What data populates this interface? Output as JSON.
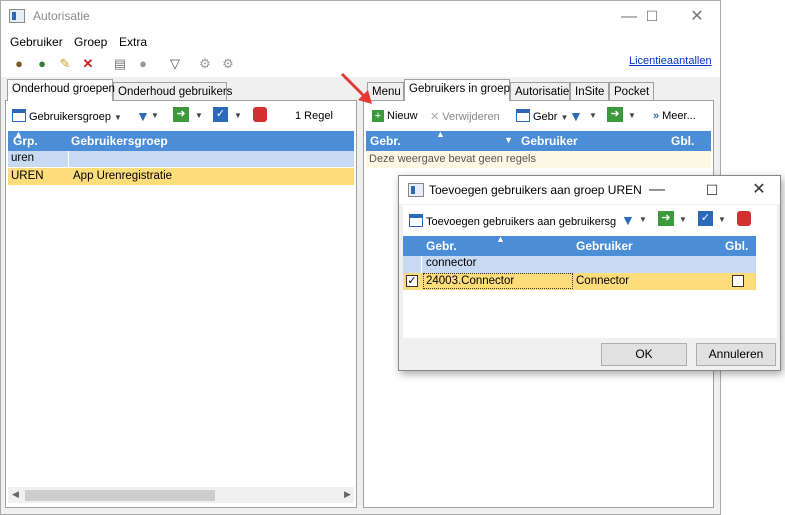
{
  "window": {
    "title": "Autorisatie"
  },
  "menu": {
    "items": [
      "Gebruiker",
      "Groep",
      "Extra"
    ]
  },
  "toolbar": {
    "link": "Licentieaantallen"
  },
  "left": {
    "tabs": [
      "Onderhoud groepen",
      "Onderhoud gebruikers"
    ],
    "buttons": {
      "group": "Gebruikersgroep",
      "count": "1 Regel"
    },
    "columns": [
      "Grp.",
      "Gebruikersgroep"
    ],
    "filter": "uren",
    "rows": [
      {
        "code": "UREN",
        "name": "App Urenregistratie"
      }
    ]
  },
  "right": {
    "tabs": [
      "Menu",
      "Gebruikers in groep",
      "Autorisatie",
      "InSite",
      "Pocket"
    ],
    "buttons": {
      "new": "Nieuw",
      "delete": "Verwijderen",
      "user": "Gebr",
      "more": "Meer..."
    },
    "columns": [
      "Gebr.",
      "Gebruiker",
      "Gbl."
    ],
    "empty": "Deze weergave bevat geen regels"
  },
  "dialog": {
    "title": "Toevoegen gebruikers aan groep UREN",
    "button": "Toevoegen gebruikers aan gebruikersg",
    "columns": [
      "Gebr.",
      "Gebruiker",
      "Gbl."
    ],
    "filter": "connector",
    "rows": [
      {
        "code": "24003.Connector",
        "name": "Connector",
        "checked": true,
        "gbl": false
      }
    ],
    "ok": "OK",
    "cancel": "Annuleren"
  },
  "colors": {
    "header": "#4b8dd6",
    "filter": "#c7daf1",
    "selected": "#fddc7b",
    "link": "#0033cc",
    "arrow": "#e53935"
  }
}
